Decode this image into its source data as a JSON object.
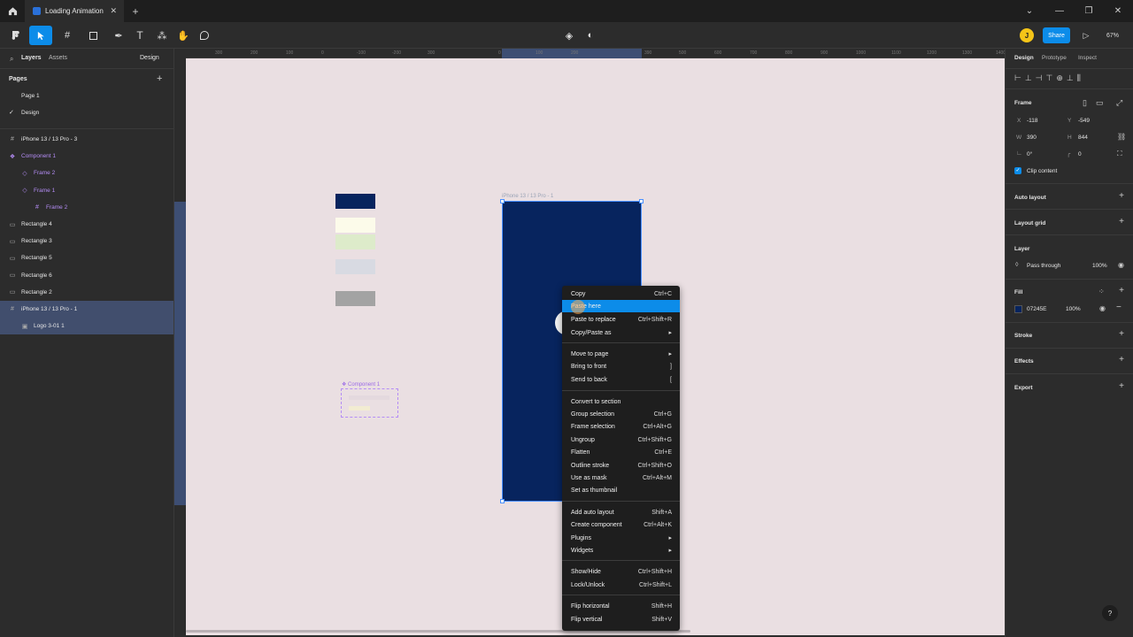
{
  "tabbar": {
    "home_icon": "home-icon",
    "tab_title": "Loading Animation",
    "new_tab": "+",
    "window_controls": [
      "⌄",
      "—",
      "❐",
      "✕"
    ]
  },
  "toolbar": {
    "share_label": "Share",
    "zoom_label": "67%",
    "avatar_initial": "J"
  },
  "left_panel": {
    "tabs": [
      "Layers",
      "Assets"
    ],
    "design_dropdown": "Design",
    "pages_title": "Pages",
    "pages": [
      "Page 1",
      "Design"
    ],
    "current_page": "Design",
    "layers": [
      {
        "name": "iPhone 13 / 13 Pro - 3",
        "icon": "frame-icon",
        "indent": 0,
        "purple": false,
        "selected": false
      },
      {
        "name": "Component 1",
        "icon": "component-icon",
        "indent": 0,
        "purple": true,
        "selected": false
      },
      {
        "name": "Frame 2",
        "icon": "instance-icon",
        "indent": 1,
        "purple": true,
        "selected": false
      },
      {
        "name": "Frame 1",
        "icon": "instance-icon",
        "indent": 1,
        "purple": true,
        "selected": false
      },
      {
        "name": "Frame 2",
        "icon": "frame-icon",
        "indent": 2,
        "purple": true,
        "selected": false
      },
      {
        "name": "Rectangle 4",
        "icon": "rectangle-icon",
        "indent": 0,
        "purple": false,
        "selected": false
      },
      {
        "name": "Rectangle 3",
        "icon": "rectangle-icon",
        "indent": 0,
        "purple": false,
        "selected": false
      },
      {
        "name": "Rectangle 5",
        "icon": "rectangle-icon",
        "indent": 0,
        "purple": false,
        "selected": false
      },
      {
        "name": "Rectangle 6",
        "icon": "rectangle-icon",
        "indent": 0,
        "purple": false,
        "selected": false
      },
      {
        "name": "Rectangle 2",
        "icon": "rectangle-icon",
        "indent": 0,
        "purple": false,
        "selected": false
      },
      {
        "name": "iPhone 13 / 13 Pro - 1",
        "icon": "frame-icon",
        "indent": 0,
        "purple": false,
        "selected": true
      },
      {
        "name": "Logo 3-01 1",
        "icon": "image-icon",
        "indent": 1,
        "purple": false,
        "selected": true
      }
    ]
  },
  "ruler": {
    "ticks": [
      "300",
      "200",
      "100",
      "0",
      "-100",
      "-200",
      "300",
      "0",
      "100",
      "200",
      "390",
      "500",
      "600",
      "700",
      "800",
      "900",
      "1000",
      "1100",
      "1200",
      "1300",
      "1400"
    ]
  },
  "canvas": {
    "frame_label": "iPhone 13 / 13 Pro - 1",
    "component_label": "Component 1",
    "frame_color": "#07245E",
    "swatches": [
      "#07245E",
      "#FCFBEA",
      "#DDEBCA",
      "#D8DAE2",
      "#A3A3A3"
    ]
  },
  "context_menu": {
    "items": [
      {
        "label": "Copy",
        "shortcut": "Ctrl+C",
        "highlight": false
      },
      {
        "label": "Paste here",
        "shortcut": "",
        "highlight": true
      },
      {
        "label": "Paste to replace",
        "shortcut": "Ctrl+Shift+R",
        "highlight": false
      },
      {
        "label": "Copy/Paste as",
        "shortcut": "▸",
        "highlight": false
      },
      {
        "label": "Move to page",
        "shortcut": "▸",
        "highlight": false
      },
      {
        "label": "Bring to front",
        "shortcut": "]",
        "highlight": false
      },
      {
        "label": "Send to back",
        "shortcut": "[",
        "highlight": false
      },
      {
        "label": "Convert to section",
        "shortcut": "",
        "highlight": false
      },
      {
        "label": "Group selection",
        "shortcut": "Ctrl+G",
        "highlight": false
      },
      {
        "label": "Frame selection",
        "shortcut": "Ctrl+Alt+G",
        "highlight": false
      },
      {
        "label": "Ungroup",
        "shortcut": "Ctrl+Shift+G",
        "highlight": false
      },
      {
        "label": "Flatten",
        "shortcut": "Ctrl+E",
        "highlight": false
      },
      {
        "label": "Outline stroke",
        "shortcut": "Ctrl+Shift+O",
        "highlight": false
      },
      {
        "label": "Use as mask",
        "shortcut": "Ctrl+Alt+M",
        "highlight": false
      },
      {
        "label": "Set as thumbnail",
        "shortcut": "",
        "highlight": false
      },
      {
        "label": "Add auto layout",
        "shortcut": "Shift+A",
        "highlight": false
      },
      {
        "label": "Create component",
        "shortcut": "Ctrl+Alt+K",
        "highlight": false
      },
      {
        "label": "Plugins",
        "shortcut": "▸",
        "highlight": false
      },
      {
        "label": "Widgets",
        "shortcut": "▸",
        "highlight": false
      },
      {
        "label": "Show/Hide",
        "shortcut": "Ctrl+Shift+H",
        "highlight": false
      },
      {
        "label": "Lock/Unlock",
        "shortcut": "Ctrl+Shift+L",
        "highlight": false
      },
      {
        "label": "Flip horizontal",
        "shortcut": "Shift+H",
        "highlight": false
      },
      {
        "label": "Flip vertical",
        "shortcut": "Shift+V",
        "highlight": false
      }
    ]
  },
  "right_panel": {
    "tabs": [
      "Design",
      "Prototype",
      "Inspect"
    ],
    "frame_title": "Frame",
    "x_label": "X",
    "x_value": "-118",
    "y_label": "Y",
    "y_value": "-549",
    "w_label": "W",
    "w_value": "390",
    "h_label": "H",
    "h_value": "844",
    "rotation_value": "0°",
    "radius_value": "0",
    "clip_content": "Clip content",
    "auto_layout": "Auto layout",
    "layout_grid": "Layout grid",
    "layer_title": "Layer",
    "blend_mode": "Pass through",
    "layer_opacity": "100%",
    "fill_title": "Fill",
    "fill_hex": "07245E",
    "fill_opacity": "100%",
    "stroke_title": "Stroke",
    "effects_title": "Effects",
    "export_title": "Export",
    "help": "?"
  }
}
